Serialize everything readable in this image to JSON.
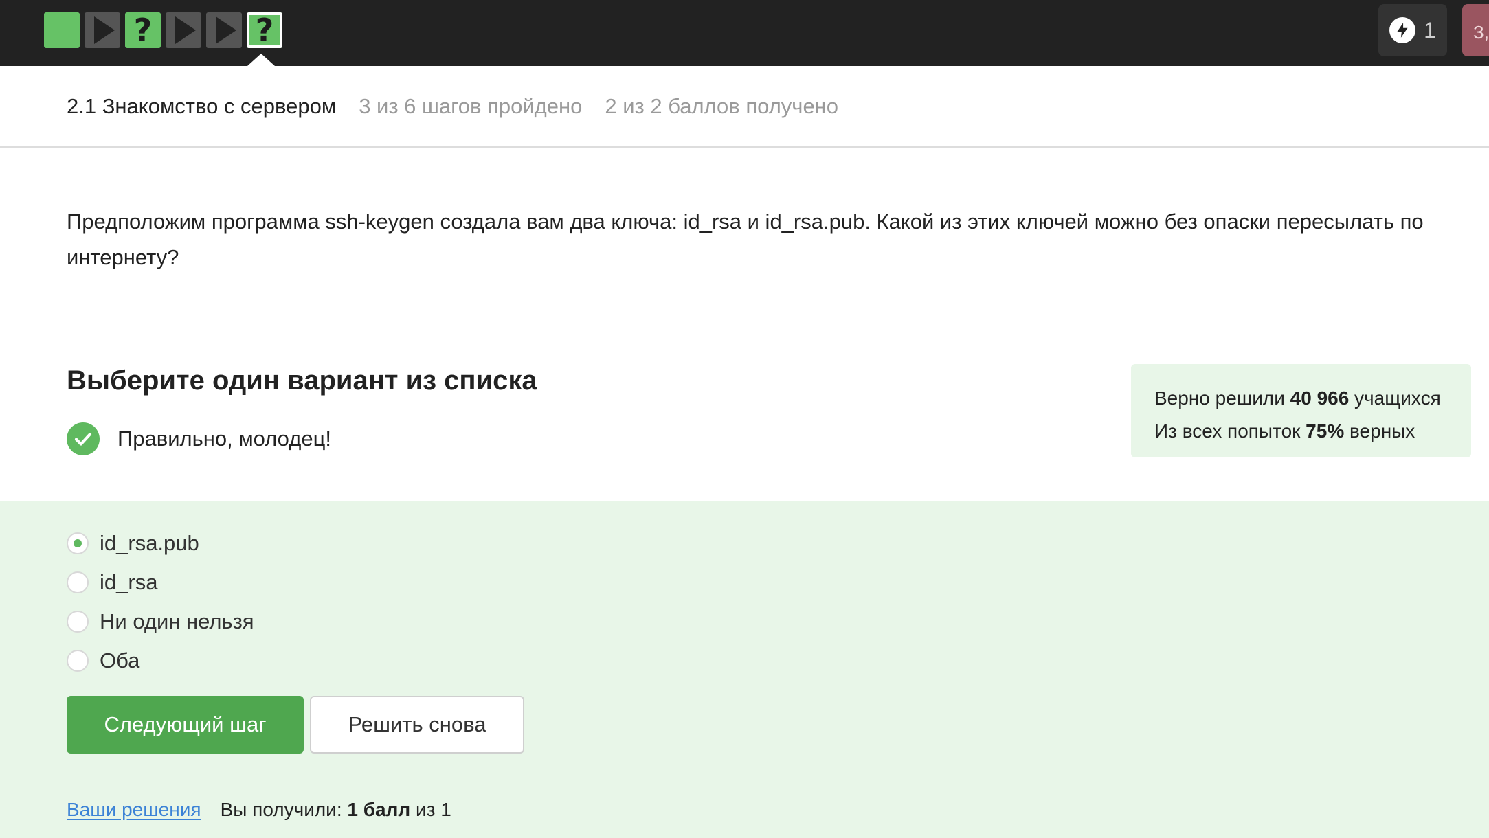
{
  "topbar": {
    "steps": [
      {
        "kind": "solved-theory",
        "glyph": ""
      },
      {
        "kind": "video",
        "glyph": ""
      },
      {
        "kind": "quiz-solved",
        "glyph": "?"
      },
      {
        "kind": "video",
        "glyph": ""
      },
      {
        "kind": "video",
        "glyph": ""
      },
      {
        "kind": "quiz-active",
        "glyph": "?"
      }
    ],
    "energy_count": "1",
    "profile_tab_text": "З,"
  },
  "lesson": {
    "title": "2.1 Знакомство с сервером",
    "steps_progress": "3 из 6 шагов пройдено",
    "points_progress": "2 из 2 баллов  получено"
  },
  "question": {
    "text": "Предположим программа ssh-keygen создала вам два ключа: id_rsa и id_rsa.pub. Какой из этих ключей можно без опаски пересылать по интернету?"
  },
  "quiz": {
    "instruction": "Выберите один вариант из списка",
    "feedback": "Правильно, молодец!",
    "options": [
      {
        "label": "id_rsa.pub",
        "selected": true
      },
      {
        "label": "id_rsa",
        "selected": false
      },
      {
        "label": "Ни один нельзя",
        "selected": false
      },
      {
        "label": "Оба",
        "selected": false
      }
    ],
    "next_button": "Следующий шаг",
    "retry_button": "Решить снова"
  },
  "stats": {
    "line1_prefix": "Верно решили ",
    "line1_value": "40 966",
    "line1_suffix": " учащихся",
    "line2_prefix": "Из всех попыток ",
    "line2_value": "75%",
    "line2_suffix": " верных"
  },
  "footer": {
    "solutions_link": "Ваши решения",
    "score_prefix": "Вы получили: ",
    "score_value": "1 балл",
    "score_suffix": " из 1"
  },
  "colors": {
    "accent_green": "#4fa74f",
    "success_bg": "#e8f6e8",
    "topbar_bg": "#222222",
    "link": "#3b82d6"
  }
}
